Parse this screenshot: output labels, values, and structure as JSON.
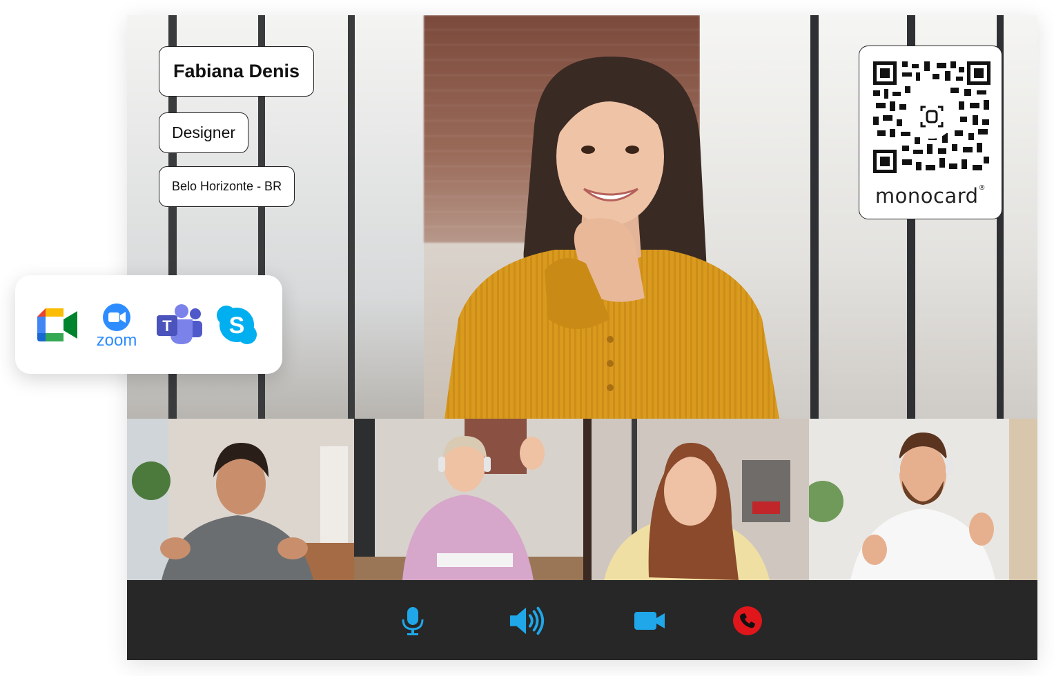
{
  "profile": {
    "name": "Fabiana Denis",
    "role": "Designer",
    "location": "Belo Horizonte - BR"
  },
  "qr_card": {
    "brand": "monocard",
    "registered_mark": "®"
  },
  "apps": [
    {
      "name": "Google Meet",
      "icon": "google-meet-icon"
    },
    {
      "name": "Zoom",
      "icon": "zoom-icon",
      "label": "zoom"
    },
    {
      "name": "Microsoft Teams",
      "icon": "teams-icon",
      "letter": "T"
    },
    {
      "name": "Skype",
      "icon": "skype-icon",
      "letter": "S"
    }
  ],
  "participants": [
    {
      "icon": "participant-video"
    },
    {
      "icon": "participant-video"
    },
    {
      "icon": "participant-video"
    },
    {
      "icon": "participant-video"
    }
  ],
  "controls": [
    {
      "icon": "microphone-icon",
      "color": "#1fa7e9"
    },
    {
      "icon": "speaker-icon",
      "color": "#1fa7e9"
    },
    {
      "icon": "video-camera-icon",
      "color": "#1fa7e9"
    },
    {
      "icon": "end-call-icon",
      "color": "#e0161b"
    }
  ],
  "colors": {
    "control_bar": "#272727",
    "accent_blue": "#1fa7e9",
    "end_call_red": "#e0161b",
    "card_border": "#222222"
  }
}
